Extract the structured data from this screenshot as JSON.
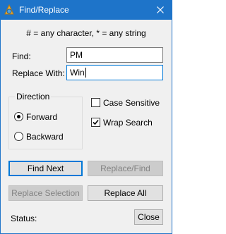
{
  "window": {
    "title": "Find/Replace"
  },
  "hint": "# = any character, * = any string",
  "find": {
    "label": "Find:",
    "value": "PM"
  },
  "replace": {
    "label": "Replace With:",
    "value": "Win"
  },
  "direction": {
    "group_label": "Direction",
    "forward_label": "Forward",
    "backward_label": "Backward",
    "selected": "Forward"
  },
  "options": {
    "case_sensitive_label": "Case Sensitive",
    "case_sensitive_checked": false,
    "wrap_search_label": "Wrap Search",
    "wrap_search_checked": true
  },
  "buttons": {
    "find_next": "Find Next",
    "replace_find": "Replace/Find",
    "replace_selection": "Replace Selection",
    "replace_all": "Replace All",
    "close": "Close"
  },
  "status": {
    "label": "Status:",
    "value": ""
  },
  "icons": {
    "app": "app-logo-icon",
    "close": "close-icon",
    "check": "check-icon"
  },
  "colors": {
    "titlebar": "#1e74c9",
    "focus_border": "#0078d7",
    "dialog_background": "#f0f0f0"
  }
}
